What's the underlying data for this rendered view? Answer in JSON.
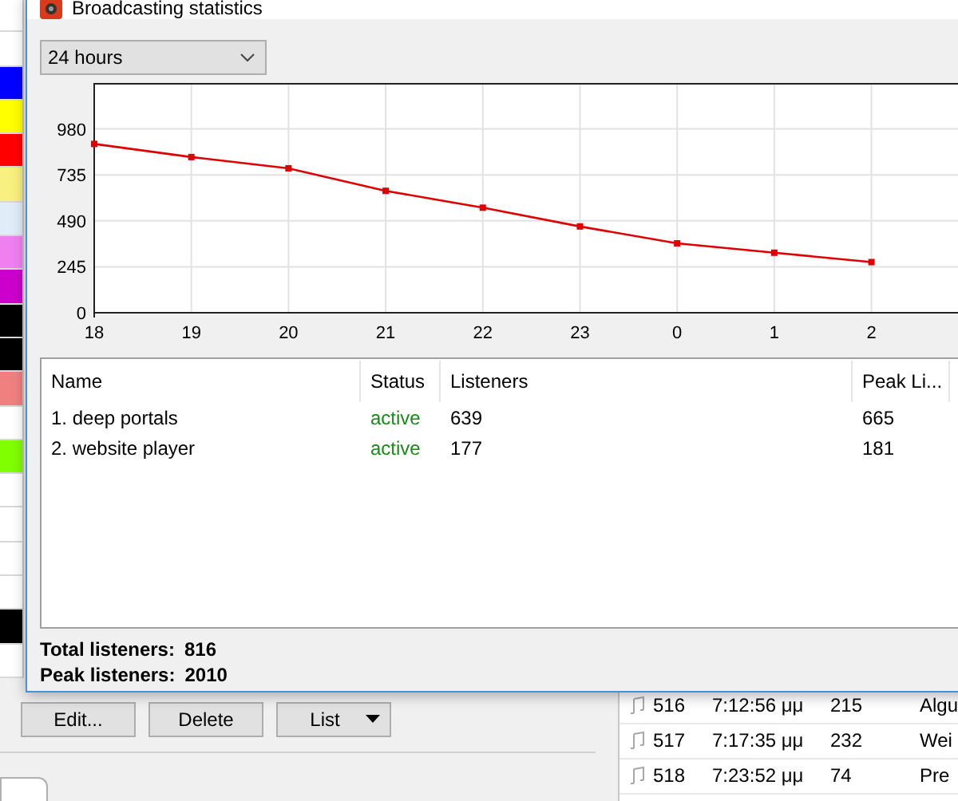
{
  "background_app": {
    "swatches": [
      {
        "color": "#ffffff"
      },
      {
        "color": "#ffffff"
      },
      {
        "color": "#0000ff"
      },
      {
        "color": "#ffff00"
      },
      {
        "color": "#ff0000"
      },
      {
        "color": "#f8f080"
      },
      {
        "color": "#e0ecf8"
      },
      {
        "color": "#f080f0"
      },
      {
        "color": "#cc00cc"
      },
      {
        "color": "#000000"
      },
      {
        "color": "#000000"
      },
      {
        "color": "#f08080"
      },
      {
        "color": "#ffffff"
      },
      {
        "color": "#80ff00"
      },
      {
        "color": "#ffffff"
      },
      {
        "color": "#ffffff"
      },
      {
        "color": "#ffffff"
      },
      {
        "color": "#ffffff"
      },
      {
        "color": "#000000"
      },
      {
        "color": "#ffffff"
      }
    ],
    "buttons": [
      {
        "label": "Edit...",
        "menu": false
      },
      {
        "label": "Delete",
        "menu": false
      },
      {
        "label": "List",
        "menu": true
      }
    ],
    "tracks": [
      {
        "number": "516",
        "time": "7:12:56 μμ",
        "listeners": "215",
        "title": "Algu"
      },
      {
        "number": "517",
        "time": "7:17:35 μμ",
        "listeners": "232",
        "title": "Wei"
      },
      {
        "number": "518",
        "time": "7:23:52 μμ",
        "listeners": "74",
        "title": "Pre"
      }
    ]
  },
  "dialog": {
    "title": "Broadcasting statistics",
    "period": "24 hours",
    "chart_data": {
      "type": "line",
      "categories": [
        "18",
        "19",
        "20",
        "21",
        "22",
        "23",
        "0",
        "1",
        "2"
      ],
      "series": [
        {
          "color": "#e00000",
          "marker": "square",
          "values": [
            900,
            830,
            770,
            650,
            560,
            460,
            370,
            320,
            270
          ]
        }
      ],
      "ylim": [
        0,
        1225
      ],
      "yticks": [
        0,
        245,
        490,
        735,
        980
      ],
      "grid": true
    },
    "table": {
      "columns": [
        "Name",
        "Status",
        "Listeners",
        "Peak Li..."
      ],
      "rows": [
        {
          "name": "1. deep portals",
          "status": "active",
          "listeners": "639",
          "peak": "665"
        },
        {
          "name": "2. website player",
          "status": "active",
          "listeners": "177",
          "peak": "181"
        }
      ]
    },
    "totals": [
      {
        "label": "Total listeners:",
        "value": "816"
      },
      {
        "label": "Peak listeners:",
        "value": "2010"
      }
    ]
  }
}
